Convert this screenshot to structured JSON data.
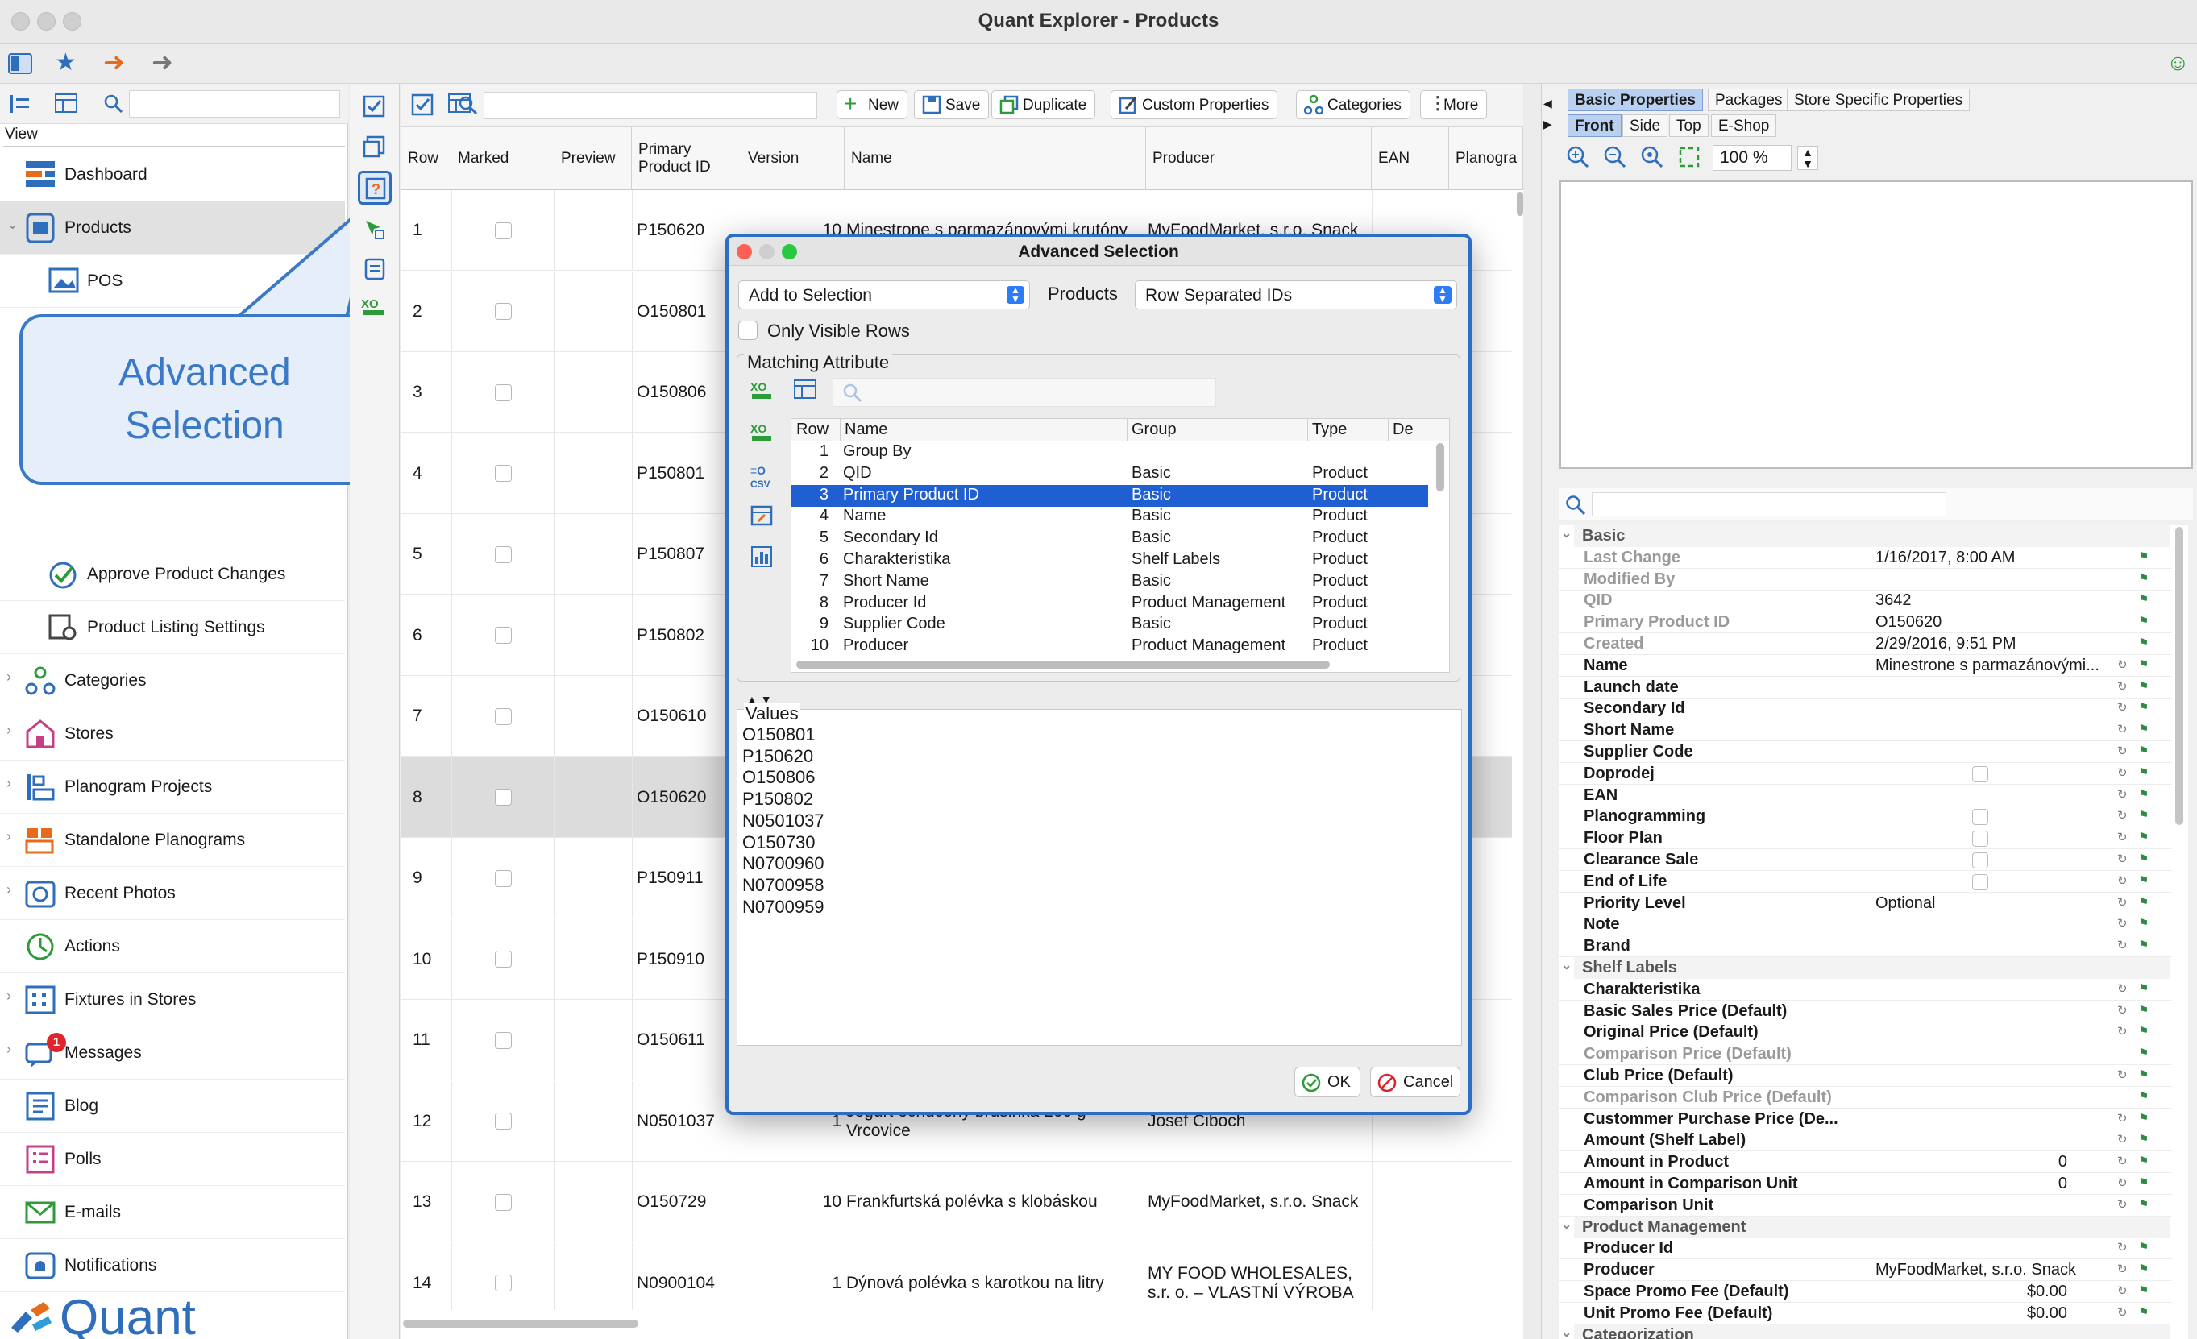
{
  "window": {
    "title": "Quant Explorer - Products"
  },
  "sidebar": {
    "view_label": "View",
    "items": [
      {
        "label": "Dashboard",
        "icon": "dashboard-icon"
      },
      {
        "label": "Products",
        "icon": "products-icon"
      },
      {
        "label": "POS",
        "icon": "pos-icon"
      },
      {
        "label": "Approve Product Changes",
        "icon": "approve-icon"
      },
      {
        "label": "Product Listing Settings",
        "icon": "listing-settings-icon"
      },
      {
        "label": "Categories",
        "icon": "categories-icon"
      },
      {
        "label": "Stores",
        "icon": "stores-icon"
      },
      {
        "label": "Planogram Projects",
        "icon": "planogram-projects-icon"
      },
      {
        "label": "Standalone Planograms",
        "icon": "standalone-planograms-icon"
      },
      {
        "label": "Recent Photos",
        "icon": "camera-icon"
      },
      {
        "label": "Actions",
        "icon": "actions-icon"
      },
      {
        "label": "Fixtures in Stores",
        "icon": "fixtures-icon"
      },
      {
        "label": "Messages",
        "icon": "messages-icon",
        "badge": "1"
      },
      {
        "label": "Blog",
        "icon": "blog-icon"
      },
      {
        "label": "Polls",
        "icon": "polls-icon"
      },
      {
        "label": "E-mails",
        "icon": "email-icon"
      },
      {
        "label": "Notifications",
        "icon": "notifications-icon"
      }
    ],
    "logo_text": "Quant"
  },
  "callout": {
    "line1": "Advanced",
    "line2": "Selection"
  },
  "toolbar": {
    "new": "New",
    "save": "Save",
    "duplicate": "Duplicate",
    "custom_properties": "Custom Properties",
    "categories": "Categories",
    "more": "More"
  },
  "table": {
    "headers": [
      "Row",
      "Marked",
      "Preview",
      "Primary Product ID",
      "Version",
      "Name",
      "Producer",
      "EAN",
      "Planogra"
    ],
    "rows": [
      {
        "row": "1",
        "id": "P150620",
        "version": "10",
        "name": "Minestrone s parmazánovými krutóny",
        "producer": "MyFoodMarket, s.r.o. Snack"
      },
      {
        "row": "2",
        "id": "O150801",
        "version": "",
        "name": "",
        "producer": ""
      },
      {
        "row": "3",
        "id": "O150806",
        "version": "",
        "name": "",
        "producer": ""
      },
      {
        "row": "4",
        "id": "P150801",
        "version": "",
        "name": "",
        "producer": ""
      },
      {
        "row": "5",
        "id": "P150807",
        "version": "",
        "name": "",
        "producer": ""
      },
      {
        "row": "6",
        "id": "P150802",
        "version": "",
        "name": "",
        "producer": ""
      },
      {
        "row": "7",
        "id": "O150610",
        "version": "",
        "name": "",
        "producer": ""
      },
      {
        "row": "8",
        "id": "O150620",
        "version": "",
        "name": "",
        "producer": ""
      },
      {
        "row": "9",
        "id": "P150911",
        "version": "",
        "name": "",
        "producer": ""
      },
      {
        "row": "10",
        "id": "P150910",
        "version": "",
        "name": "",
        "producer": ""
      },
      {
        "row": "11",
        "id": "O150611",
        "version": "",
        "name": "",
        "producer": ""
      },
      {
        "row": "12",
        "id": "N0501037",
        "version": "1",
        "name": "Jogurt ochucený brusinka 200 g Vrcovice",
        "producer": "Josef Ciboch"
      },
      {
        "row": "13",
        "id": "O150729",
        "version": "10",
        "name": "Frankfurtská polévka s klobáskou",
        "producer": "MyFoodMarket, s.r.o. Snack"
      },
      {
        "row": "14",
        "id": "N0900104",
        "version": "1",
        "name": "Dýnová polévka s karotkou na litry",
        "producer": "MY FOOD WHOLESALES, s.r. o. – VLASTNÍ VÝROBA"
      }
    ]
  },
  "dialog": {
    "title": "Advanced Selection",
    "mode": "Add to Selection",
    "entity_label": "Products",
    "format": "Row Separated IDs",
    "only_visible": "Only Visible Rows",
    "matching_label": "Matching Attribute",
    "columns": [
      "Row",
      "Name",
      "Group",
      "Type",
      "De"
    ],
    "attributes": [
      {
        "row": "1",
        "name": "Group By",
        "group": "",
        "type": ""
      },
      {
        "row": "2",
        "name": "QID",
        "group": "Basic",
        "type": "Product"
      },
      {
        "row": "3",
        "name": "Primary Product ID",
        "group": "Basic",
        "type": "Product"
      },
      {
        "row": "4",
        "name": "Name",
        "group": "Basic",
        "type": "Product"
      },
      {
        "row": "5",
        "name": "Secondary Id",
        "group": "Basic",
        "type": "Product"
      },
      {
        "row": "6",
        "name": "Charakteristika",
        "group": "Shelf Labels",
        "type": "Product"
      },
      {
        "row": "7",
        "name": "Short Name",
        "group": "Basic",
        "type": "Product"
      },
      {
        "row": "8",
        "name": "Producer Id",
        "group": "Product Management",
        "type": "Product"
      },
      {
        "row": "9",
        "name": "Supplier Code",
        "group": "Basic",
        "type": "Product"
      },
      {
        "row": "10",
        "name": "Producer",
        "group": "Product Management",
        "type": "Product"
      }
    ],
    "values_label": "Values",
    "values": [
      "O150801",
      "P150620",
      "O150806",
      "P150802",
      "N0501037",
      "O150730",
      "N0700960",
      "N0700958",
      "N0700959"
    ],
    "ok": "OK",
    "cancel": "Cancel"
  },
  "right": {
    "tabs": [
      "Basic Properties",
      "Packages",
      "Store Specific Properties"
    ],
    "view_tabs": [
      "Front",
      "Side",
      "Top",
      "E-Shop"
    ],
    "zoom": "100 %",
    "properties": [
      {
        "section": "Basic"
      },
      {
        "name": "Last Change",
        "value": "1/16/2017, 8:00 AM",
        "dis": true
      },
      {
        "name": "Modified By",
        "value": "",
        "dis": true
      },
      {
        "name": "QID",
        "value": "3642",
        "dis": true
      },
      {
        "name": "Primary Product ID",
        "value": "O150620",
        "dis": true
      },
      {
        "name": "Created",
        "value": "2/29/2016, 9:51 PM",
        "dis": true
      },
      {
        "name": "Name",
        "value": "Minestrone s parmazánovými..."
      },
      {
        "name": "Launch date",
        "value": ""
      },
      {
        "name": "Secondary Id",
        "value": ""
      },
      {
        "name": "Short Name",
        "value": ""
      },
      {
        "name": "Supplier Code",
        "value": ""
      },
      {
        "name": "Doprodej",
        "value": "",
        "check": true
      },
      {
        "name": "EAN",
        "value": ""
      },
      {
        "name": "Planogramming",
        "value": "",
        "check": true
      },
      {
        "name": "Floor Plan",
        "value": "",
        "check": true
      },
      {
        "name": "Clearance Sale",
        "value": "",
        "check": true
      },
      {
        "name": "End of Life",
        "value": "",
        "check": true
      },
      {
        "name": "Priority Level",
        "value": "Optional"
      },
      {
        "name": "Note",
        "value": ""
      },
      {
        "name": "Brand",
        "value": ""
      },
      {
        "section": "Shelf Labels"
      },
      {
        "name": "Charakteristika",
        "value": ""
      },
      {
        "name": "Basic Sales Price (Default)",
        "value": ""
      },
      {
        "name": "Original Price (Default)",
        "value": ""
      },
      {
        "name": "Comparison Price (Default)",
        "value": "",
        "dis": true
      },
      {
        "name": "Club Price (Default)",
        "value": ""
      },
      {
        "name": "Comparison Club Price (Default)",
        "value": "",
        "dis": true
      },
      {
        "name": "Custommer Purchase Price (De...",
        "value": ""
      },
      {
        "name": "Amount (Shelf Label)",
        "value": ""
      },
      {
        "name": "Amount in Product",
        "value": "0",
        "right": true
      },
      {
        "name": "Amount in Comparison Unit",
        "value": "0",
        "right": true
      },
      {
        "name": "Comparison Unit",
        "value": ""
      },
      {
        "section": "Product Management"
      },
      {
        "name": "Producer Id",
        "value": ""
      },
      {
        "name": "Producer",
        "value": "MyFoodMarket, s.r.o. Snack"
      },
      {
        "name": "Space Promo Fee (Default)",
        "value": "$0.00",
        "right": true
      },
      {
        "name": "Unit Promo Fee (Default)",
        "value": "$0.00",
        "right": true
      },
      {
        "section": "Categorization"
      }
    ]
  }
}
